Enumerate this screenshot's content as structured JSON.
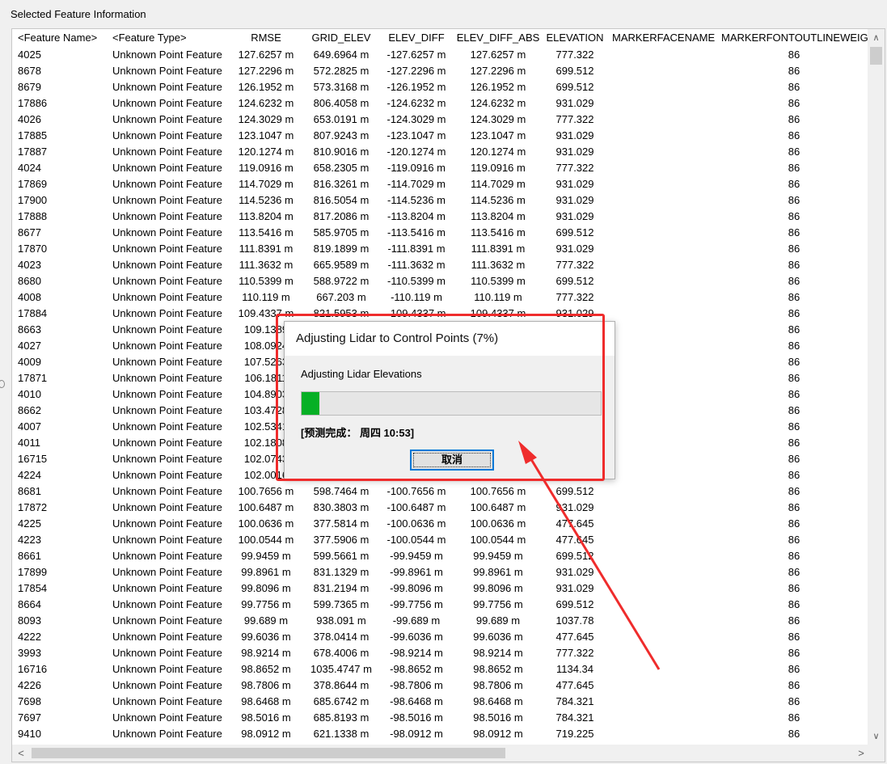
{
  "panel": {
    "title": "Selected Feature Information"
  },
  "table": {
    "columns": [
      "<Feature Name>",
      "<Feature Type>",
      "RMSE",
      "GRID_ELEV",
      "ELEV_DIFF",
      "ELEV_DIFF_ABS",
      "ELEVATION",
      "MARKERFACENAME",
      "MARKERFONTOUTLINEWEIG"
    ],
    "rows": [
      [
        "4025",
        "Unknown Point Feature",
        "127.6257 m",
        "649.6964 m",
        "-127.6257 m",
        "127.6257 m",
        "777.322",
        "",
        "86"
      ],
      [
        "8678",
        "Unknown Point Feature",
        "127.2296 m",
        "572.2825 m",
        "-127.2296 m",
        "127.2296 m",
        "699.512",
        "",
        "86"
      ],
      [
        "8679",
        "Unknown Point Feature",
        "126.1952 m",
        "573.3168 m",
        "-126.1952 m",
        "126.1952 m",
        "699.512",
        "",
        "86"
      ],
      [
        "17886",
        "Unknown Point Feature",
        "124.6232 m",
        "806.4058 m",
        "-124.6232 m",
        "124.6232 m",
        "931.029",
        "",
        "86"
      ],
      [
        "4026",
        "Unknown Point Feature",
        "124.3029 m",
        "653.0191 m",
        "-124.3029 m",
        "124.3029 m",
        "777.322",
        "",
        "86"
      ],
      [
        "17885",
        "Unknown Point Feature",
        "123.1047 m",
        "807.9243 m",
        "-123.1047 m",
        "123.1047 m",
        "931.029",
        "",
        "86"
      ],
      [
        "17887",
        "Unknown Point Feature",
        "120.1274 m",
        "810.9016 m",
        "-120.1274 m",
        "120.1274 m",
        "931.029",
        "",
        "86"
      ],
      [
        "4024",
        "Unknown Point Feature",
        "119.0916 m",
        "658.2305 m",
        "-119.0916 m",
        "119.0916 m",
        "777.322",
        "",
        "86"
      ],
      [
        "17869",
        "Unknown Point Feature",
        "114.7029 m",
        "816.3261 m",
        "-114.7029 m",
        "114.7029 m",
        "931.029",
        "",
        "86"
      ],
      [
        "17900",
        "Unknown Point Feature",
        "114.5236 m",
        "816.5054 m",
        "-114.5236 m",
        "114.5236 m",
        "931.029",
        "",
        "86"
      ],
      [
        "17888",
        "Unknown Point Feature",
        "113.8204 m",
        "817.2086 m",
        "-113.8204 m",
        "113.8204 m",
        "931.029",
        "",
        "86"
      ],
      [
        "8677",
        "Unknown Point Feature",
        "113.5416 m",
        "585.9705 m",
        "-113.5416 m",
        "113.5416 m",
        "699.512",
        "",
        "86"
      ],
      [
        "17870",
        "Unknown Point Feature",
        "111.8391 m",
        "819.1899 m",
        "-111.8391 m",
        "111.8391 m",
        "931.029",
        "",
        "86"
      ],
      [
        "4023",
        "Unknown Point Feature",
        "111.3632 m",
        "665.9589 m",
        "-111.3632 m",
        "111.3632 m",
        "777.322",
        "",
        "86"
      ],
      [
        "8680",
        "Unknown Point Feature",
        "110.5399 m",
        "588.9722 m",
        "-110.5399 m",
        "110.5399 m",
        "699.512",
        "",
        "86"
      ],
      [
        "4008",
        "Unknown Point Feature",
        "110.119 m",
        "667.203 m",
        "-110.119 m",
        "110.119 m",
        "777.322",
        "",
        "86"
      ],
      [
        "17884",
        "Unknown Point Feature",
        "109.4337 m",
        "821.5953 m",
        "-109.4337 m",
        "109.4337 m",
        "931.029",
        "",
        "86"
      ],
      [
        "8663",
        "Unknown Point Feature",
        "109.1389",
        "",
        "",
        "",
        "",
        "",
        "86"
      ],
      [
        "4027",
        "Unknown Point Feature",
        "108.0924",
        "",
        "",
        "",
        "",
        "",
        "86"
      ],
      [
        "4009",
        "Unknown Point Feature",
        "107.5263",
        "",
        "",
        "",
        "",
        "",
        "86"
      ],
      [
        "17871",
        "Unknown Point Feature",
        "106.1811",
        "",
        "",
        "",
        "",
        "",
        "86"
      ],
      [
        "4010",
        "Unknown Point Feature",
        "104.8903",
        "",
        "",
        "",
        "",
        "",
        "86"
      ],
      [
        "8662",
        "Unknown Point Feature",
        "103.4728",
        "",
        "",
        "",
        "",
        "",
        "86"
      ],
      [
        "4007",
        "Unknown Point Feature",
        "102.5341",
        "",
        "",
        "",
        "",
        "",
        "86"
      ],
      [
        "4011",
        "Unknown Point Feature",
        "102.1808",
        "",
        "",
        "",
        "",
        "",
        "86"
      ],
      [
        "16715",
        "Unknown Point Feature",
        "102.0743",
        "",
        "",
        "",
        "",
        "",
        "86"
      ],
      [
        "4224",
        "Unknown Point Feature",
        "102.0016",
        "",
        "",
        "",
        "",
        "",
        "86"
      ],
      [
        "8681",
        "Unknown Point Feature",
        "100.7656 m",
        "598.7464 m",
        "-100.7656 m",
        "100.7656 m",
        "699.512",
        "",
        "86"
      ],
      [
        "17872",
        "Unknown Point Feature",
        "100.6487 m",
        "830.3803 m",
        "-100.6487 m",
        "100.6487 m",
        "931.029",
        "",
        "86"
      ],
      [
        "4225",
        "Unknown Point Feature",
        "100.0636 m",
        "377.5814 m",
        "-100.0636 m",
        "100.0636 m",
        "477.645",
        "",
        "86"
      ],
      [
        "4223",
        "Unknown Point Feature",
        "100.0544 m",
        "377.5906 m",
        "-100.0544 m",
        "100.0544 m",
        "477.645",
        "",
        "86"
      ],
      [
        "8661",
        "Unknown Point Feature",
        "99.9459 m",
        "599.5661 m",
        "-99.9459 m",
        "99.9459 m",
        "699.512",
        "",
        "86"
      ],
      [
        "17899",
        "Unknown Point Feature",
        "99.8961 m",
        "831.1329 m",
        "-99.8961 m",
        "99.8961 m",
        "931.029",
        "",
        "86"
      ],
      [
        "17854",
        "Unknown Point Feature",
        "99.8096 m",
        "831.2194 m",
        "-99.8096 m",
        "99.8096 m",
        "931.029",
        "",
        "86"
      ],
      [
        "8664",
        "Unknown Point Feature",
        "99.7756 m",
        "599.7365 m",
        "-99.7756 m",
        "99.7756 m",
        "699.512",
        "",
        "86"
      ],
      [
        "8093",
        "Unknown Point Feature",
        "99.689 m",
        "938.091 m",
        "-99.689 m",
        "99.689 m",
        "1037.78",
        "",
        "86"
      ],
      [
        "4222",
        "Unknown Point Feature",
        "99.6036 m",
        "378.0414 m",
        "-99.6036 m",
        "99.6036 m",
        "477.645",
        "",
        "86"
      ],
      [
        "3993",
        "Unknown Point Feature",
        "98.9214 m",
        "678.4006 m",
        "-98.9214 m",
        "98.9214 m",
        "777.322",
        "",
        "86"
      ],
      [
        "16716",
        "Unknown Point Feature",
        "98.8652 m",
        "1035.4747 m",
        "-98.8652 m",
        "98.8652 m",
        "1134.34",
        "",
        "86"
      ],
      [
        "4226",
        "Unknown Point Feature",
        "98.7806 m",
        "378.8644 m",
        "-98.7806 m",
        "98.7806 m",
        "477.645",
        "",
        "86"
      ],
      [
        "7698",
        "Unknown Point Feature",
        "98.6468 m",
        "685.6742 m",
        "-98.6468 m",
        "98.6468 m",
        "784.321",
        "",
        "86"
      ],
      [
        "7697",
        "Unknown Point Feature",
        "98.5016 m",
        "685.8193 m",
        "-98.5016 m",
        "98.5016 m",
        "784.321",
        "",
        "86"
      ],
      [
        "9410",
        "Unknown Point Feature",
        "98.0912 m",
        "621.1338 m",
        "-98.0912 m",
        "98.0912 m",
        "719.225",
        "",
        "86"
      ]
    ]
  },
  "scroll": {
    "up_icon": "chevron-up-icon",
    "down_icon": "chevron-down-icon",
    "left_icon": "chevron-left-icon",
    "right_icon": "chevron-right-icon"
  },
  "dialog": {
    "title": "Adjusting Lidar to Control Points (7%)",
    "status": "Adjusting Lidar Elevations",
    "progress_fraction": 0.06,
    "eta": "[预测完成： 周四 10:53]",
    "cancel_label": "取消"
  },
  "colors": {
    "progress_fill": "#06b025",
    "annotation_red": "#ef2c2c",
    "focus_blue": "#0078d7"
  }
}
